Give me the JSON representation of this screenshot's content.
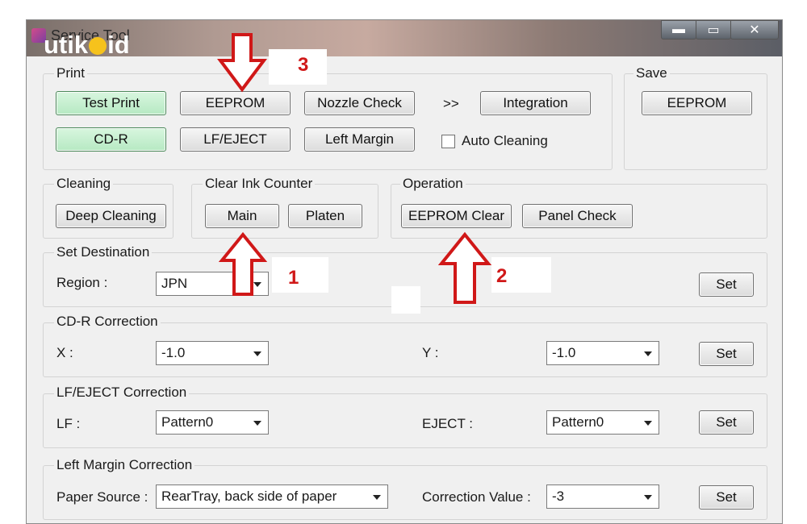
{
  "window": {
    "title": "Service Tool",
    "controls": {
      "minimize": "▬",
      "maximize": "▭",
      "close": "✕"
    }
  },
  "watermark": {
    "left": "utik",
    "right": "id"
  },
  "print": {
    "label": "Print",
    "test_print": "Test Print",
    "eeprom": "EEPROM",
    "nozzle_check": "Nozzle Check",
    "more": ">>",
    "integration": "Integration",
    "cd_r": "CD-R",
    "lf_eject": "LF/EJECT",
    "left_margin": "Left Margin",
    "auto_cleaning": "Auto Cleaning"
  },
  "save": {
    "label": "Save",
    "eeprom": "EEPROM"
  },
  "cleaning": {
    "label": "Cleaning",
    "deep_cleaning": "Deep Cleaning"
  },
  "clear_ink_counter": {
    "label": "Clear Ink Counter",
    "main": "Main",
    "platen": "Platen"
  },
  "operation": {
    "label": "Operation",
    "eeprom_clear": "EEPROM Clear",
    "panel_check": "Panel Check"
  },
  "set_destination": {
    "label": "Set Destination",
    "region_label": "Region :",
    "region_value": "JPN",
    "set": "Set"
  },
  "cdr_correction": {
    "label": "CD-R Correction",
    "x_label": "X :",
    "x_value": "-1.0",
    "y_label": "Y :",
    "y_value": "-1.0",
    "set": "Set"
  },
  "lf_eject_correction": {
    "label": "LF/EJECT Correction",
    "lf_label": "LF :",
    "lf_value": "Pattern0",
    "eject_label": "EJECT :",
    "eject_value": "Pattern0",
    "set": "Set"
  },
  "left_margin_correction": {
    "label": "Left Margin Correction",
    "paper_source_label": "Paper Source :",
    "paper_source_value": "RearTray, back side of paper",
    "correction_label": "Correction Value :",
    "correction_value": "-3",
    "set": "Set"
  },
  "annotations": {
    "one": "1",
    "two": "2",
    "three": "3"
  },
  "colors": {
    "accent_green": "#b6e9c2",
    "annotation_red": "#d01818"
  }
}
